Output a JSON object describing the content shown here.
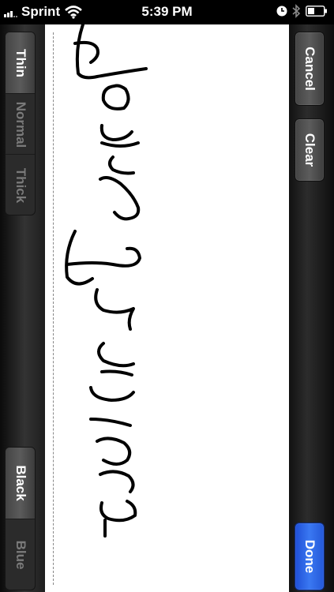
{
  "status_bar": {
    "carrier": "Sprint",
    "time": "5:39 PM",
    "icons": [
      "signal-icon",
      "wifi-icon",
      "clock-icon",
      "bluetooth-icon",
      "battery-icon"
    ]
  },
  "pen_size": {
    "options": [
      "Thin",
      "Normal",
      "Thick"
    ],
    "selected": "Thin"
  },
  "pen_color": {
    "options": [
      "Black",
      "Blue"
    ],
    "selected": "Black"
  },
  "actions": {
    "cancel_label": "Cancel",
    "clear_label": "Clear",
    "done_label": "Done"
  },
  "colors": {
    "done_button": "#2f6bec",
    "canvas": "#ffffff",
    "ink": "#000000"
  }
}
